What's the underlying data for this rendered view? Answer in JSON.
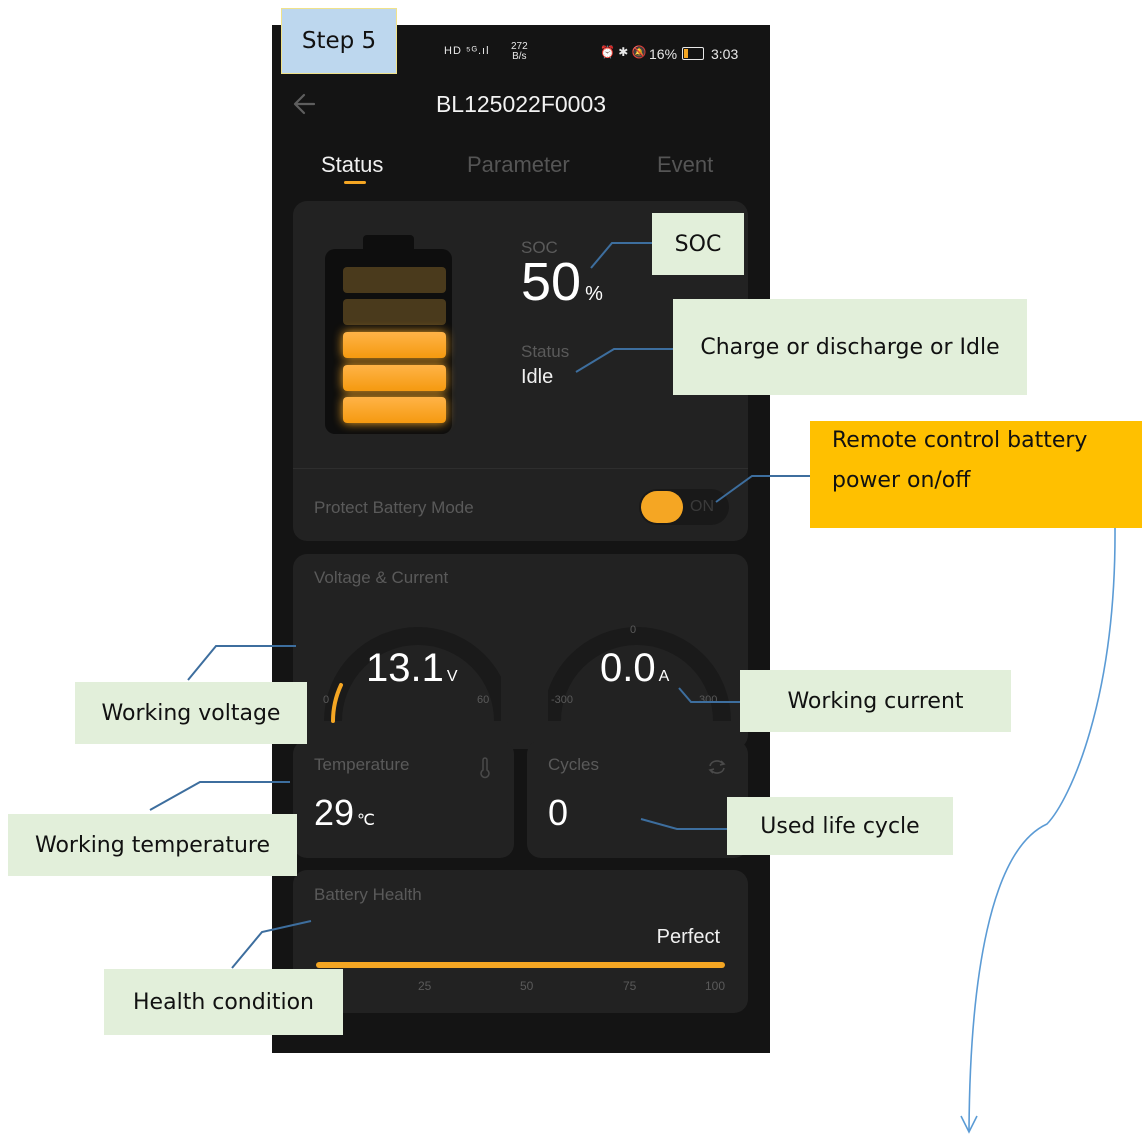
{
  "status_bar": {
    "network_left": "HD ⁵ᴳ.ıl",
    "speed_value": "272",
    "speed_unit": "B/s",
    "icons_right": "⏰ ✱ 🔕",
    "battery_percent": "16%",
    "time": "3:03"
  },
  "header": {
    "back_icon": "arrow-left-icon",
    "device_id": "BL125022F0003"
  },
  "tabs": [
    {
      "label": "Status",
      "active": true
    },
    {
      "label": "Parameter",
      "active": false
    },
    {
      "label": "Event",
      "active": false
    }
  ],
  "battery_card": {
    "soc_label": "SOC",
    "soc_value": "50",
    "soc_unit": "%",
    "soc_fraction": 0.5,
    "status_label": "Status",
    "status_value": "Idle",
    "protect_label": "Protect Battery Mode",
    "protect_toggle_text": "ON",
    "protect_on": true
  },
  "voltage_current": {
    "title": "Voltage & Current",
    "voltage": {
      "value": "13.1",
      "unit": "V",
      "min": "0",
      "max": "60"
    },
    "current": {
      "value": "0.0",
      "unit": "A",
      "min": "-300",
      "mid": "0",
      "max": "300"
    }
  },
  "temperature": {
    "title": "Temperature",
    "value": "29",
    "unit": "℃",
    "icon": "thermometer-icon"
  },
  "cycles": {
    "title": "Cycles",
    "value": "0",
    "icon": "cycle-icon"
  },
  "health": {
    "title": "Battery Health",
    "status": "Perfect",
    "level": 1.0,
    "ticks": [
      "25",
      "50",
      "75",
      "100"
    ]
  },
  "annotations": {
    "step": "Step 5",
    "soc": "SOC",
    "status": "Charge or discharge or Idle",
    "remote_line1": "Remote control battery",
    "remote_line2": "power on/off",
    "working_voltage": "Working voltage",
    "working_current": "Working current",
    "working_temperature": "Working temperature",
    "used_life_cycle": "Used life cycle",
    "health_condition": "Health condition"
  },
  "colors": {
    "accent_orange": "#f5a623",
    "annotation_green": "#e2efda",
    "annotation_orange": "#ffc000",
    "step_blue": "#bdd7ee",
    "leader_line": "#3d6e9e",
    "arrow_blue": "#5b9bd5"
  }
}
